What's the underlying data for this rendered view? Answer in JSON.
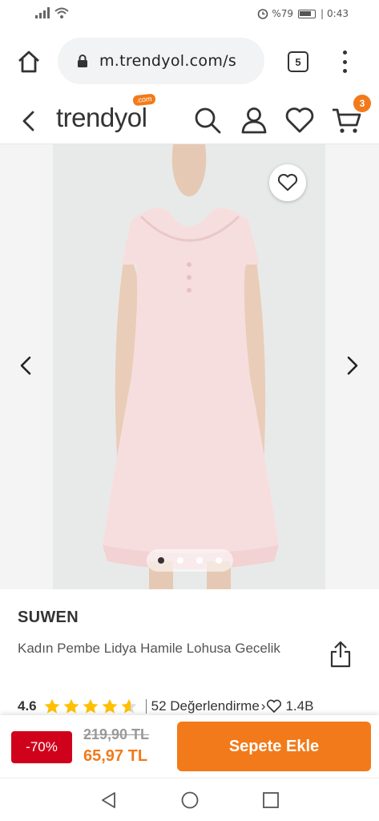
{
  "status_bar": {
    "battery": "%79",
    "time": "0:43"
  },
  "browser": {
    "url": "m.trendyol.com/s",
    "tab_count": "5"
  },
  "header": {
    "logo": "trendyol",
    "logo_suffix": ".com",
    "cart_count": "3"
  },
  "gallery": {
    "total_images": 4,
    "active_index": 0
  },
  "product": {
    "brand": "SUWEN",
    "title": "Kadın Pembe Lidya Hamile Lohusa Gecelik",
    "rating": "4.6",
    "rating_stars": 4.6,
    "reviews": "52  Değerlendirme",
    "favorites": "1.4B"
  },
  "buy_bar": {
    "discount": "-70%",
    "old_price": "219,90 TL",
    "new_price": "65,97 TL",
    "add_to_cart": "Sepete Ekle"
  },
  "colors": {
    "brand_orange": "#f27a1a",
    "discount_red": "#d0021b",
    "star_yellow": "#ffc000"
  },
  "icons": [
    "wifi-icon",
    "alarm-icon",
    "home-icon",
    "lock-icon",
    "tabs-icon",
    "menu-icon",
    "back-icon",
    "search-icon",
    "user-icon",
    "heart-icon",
    "cart-icon",
    "share-icon",
    "star-icon",
    "chevron-left-icon",
    "chevron-right-icon"
  ]
}
